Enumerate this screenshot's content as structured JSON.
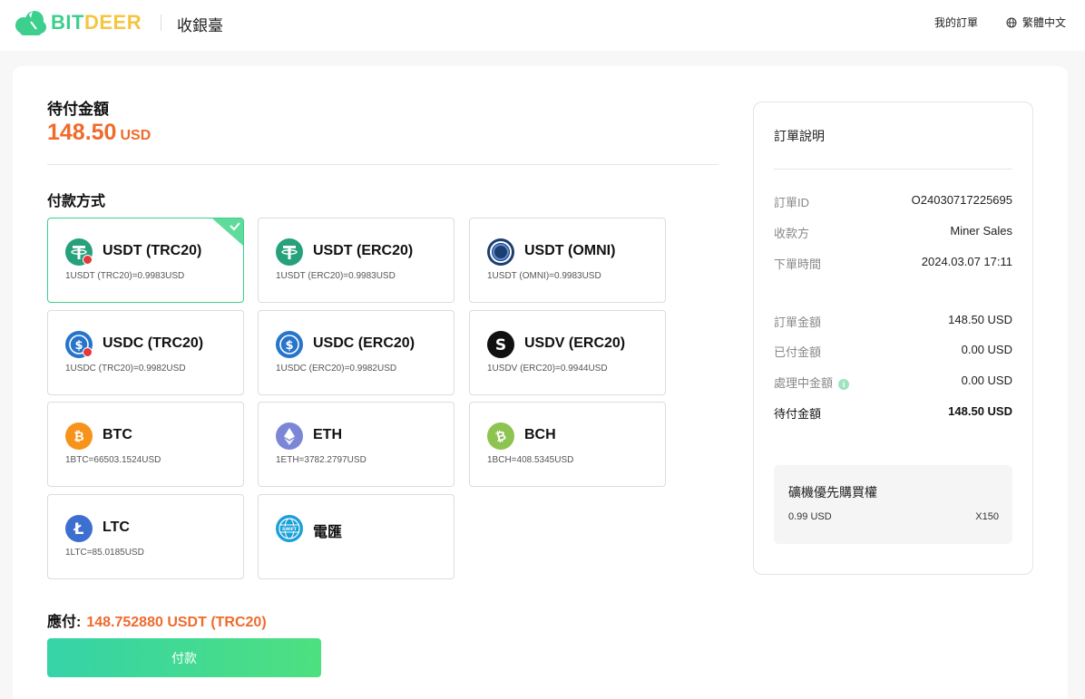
{
  "header": {
    "brand_part1": "BIT",
    "brand_part2": "DEER",
    "title": "收銀臺",
    "my_orders": "我的訂單",
    "language": "繁體中文"
  },
  "payment": {
    "amount_label": "待付金額",
    "amount_value": "148.50",
    "amount_currency": "USD",
    "methods_label": "付款方式",
    "methods": [
      {
        "name": "USDT (TRC20)",
        "rate": "1USDT (TRC20)=0.9983USD",
        "icon": "tether-icon",
        "selected": true,
        "badge": true
      },
      {
        "name": "USDT (ERC20)",
        "rate": "1USDT (ERC20)=0.9983USD",
        "icon": "tether-icon",
        "selected": false,
        "badge": false
      },
      {
        "name": "USDT (OMNI)",
        "rate": "1USDT (OMNI)=0.9983USD",
        "icon": "omni-icon",
        "selected": false,
        "badge": false
      },
      {
        "name": "USDC (TRC20)",
        "rate": "1USDC (TRC20)=0.9982USD",
        "icon": "usdc-icon",
        "selected": false,
        "badge": true
      },
      {
        "name": "USDC (ERC20)",
        "rate": "1USDC (ERC20)=0.9982USD",
        "icon": "usdc-icon",
        "selected": false,
        "badge": false
      },
      {
        "name": "USDV (ERC20)",
        "rate": "1USDV (ERC20)=0.9944USD",
        "icon": "usdv-icon",
        "selected": false,
        "badge": false
      },
      {
        "name": "BTC",
        "rate": "1BTC=66503.1524USD",
        "icon": "bitcoin-icon",
        "selected": false,
        "badge": false
      },
      {
        "name": "ETH",
        "rate": "1ETH=3782.2797USD",
        "icon": "ethereum-icon",
        "selected": false,
        "badge": false
      },
      {
        "name": "BCH",
        "rate": "1BCH=408.5345USD",
        "icon": "bitcoin-cash-icon",
        "selected": false,
        "badge": false
      },
      {
        "name": "LTC",
        "rate": "1LTC=85.0185USD",
        "icon": "litecoin-icon",
        "selected": false,
        "badge": false
      },
      {
        "name": "電匯",
        "rate": "",
        "icon": "swift-icon",
        "selected": false,
        "badge": false
      }
    ],
    "due_label": "應付:",
    "due_value": "148.752880 USDT (TRC20)",
    "pay_button": "付款"
  },
  "order": {
    "title": "訂單說明",
    "id_label": "訂單ID",
    "id_value": "O24030717225695",
    "payee_label": "收款方",
    "payee_value": "Miner Sales",
    "time_label": "下單時間",
    "time_value": "2024.03.07 17:11",
    "order_amount_label": "訂單金額",
    "order_amount_value": "148.50 USD",
    "paid_label": "已付金額",
    "paid_value": "0.00 USD",
    "processing_label": "處理中金額",
    "processing_value": "0.00 USD",
    "pending_label": "待付金額",
    "pending_value": "148.50 USD",
    "item": {
      "title": "礦機優先購買權",
      "price": "0.99 USD",
      "quantity": "X150"
    }
  },
  "colors": {
    "accent_orange": "#ef6b2c",
    "brand_green": "#3ccf8e",
    "brand_yellow": "#f5c542"
  }
}
